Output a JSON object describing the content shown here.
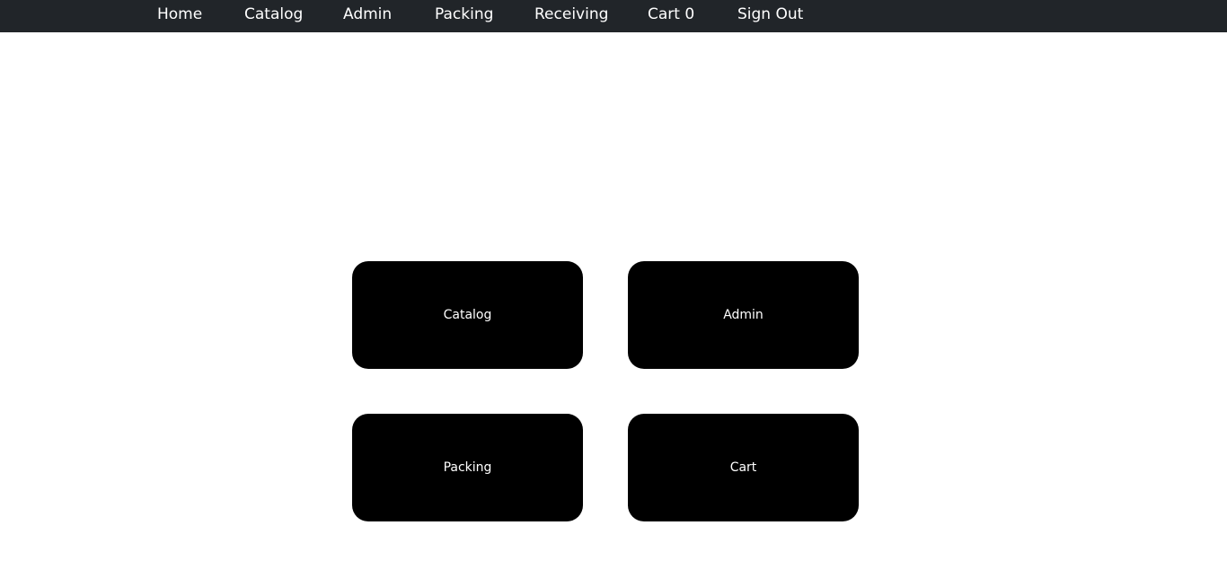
{
  "nav": {
    "home": "Home",
    "catalog": "Catalog",
    "admin": "Admin",
    "packing": "Packing",
    "receiving": "Receiving",
    "cart": "Cart 0",
    "sign_out": "Sign Out"
  },
  "tiles": {
    "catalog": "Catalog",
    "admin": "Admin",
    "packing": "Packing",
    "cart": "Cart"
  },
  "colors": {
    "navbar_bg": "#212529",
    "tile_bg": "#000000",
    "text": "#ffffff"
  }
}
